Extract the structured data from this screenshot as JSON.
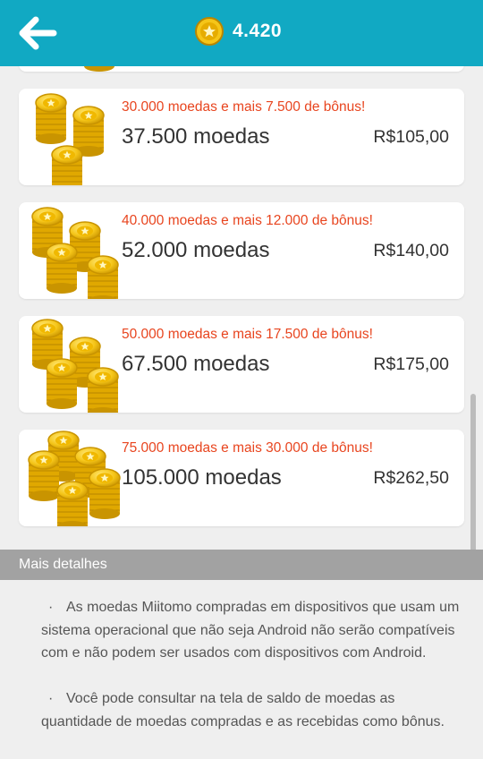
{
  "header": {
    "back_icon": "arrow-left-icon",
    "coin_icon": "star-coin-icon",
    "balance": "4.420",
    "background_color": "#11a9c3"
  },
  "offers": [
    {
      "bonus_text": "30.000 moedas e mais 7.500 de bônus!",
      "amount": "37.500 moedas",
      "price": "R$105,00"
    },
    {
      "bonus_text": "40.000 moedas e mais 12.000 de bônus!",
      "amount": "52.000 moedas",
      "price": "R$140,00"
    },
    {
      "bonus_text": "50.000 moedas e mais 17.500 de bônus!",
      "amount": "67.500 moedas",
      "price": "R$175,00"
    },
    {
      "bonus_text": "75.000 moedas e mais 30.000 de bônus!",
      "amount": "105.000 moedas",
      "price": "R$262,50"
    }
  ],
  "colors": {
    "bonus": "#e8451f",
    "coin": "#f5c518"
  },
  "details": {
    "title": "Mais detalhes",
    "bullet": "·",
    "paragraphs": [
      "As moedas Miitomo compradas em dispositivos que usam um sistema operacional que não seja Android não serão compatíveis com e não podem ser usados com dispositivos com Android.",
      "Você pode consultar na tela de saldo de moedas as quantidade de moedas compradas e as recebidas como bônus."
    ]
  }
}
